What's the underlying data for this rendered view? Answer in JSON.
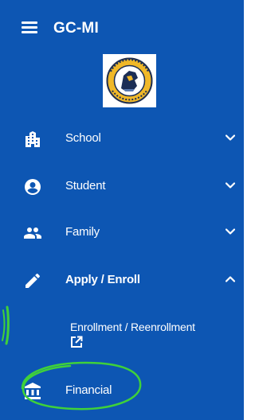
{
  "header": {
    "title": "GC-MI",
    "menu_icon": "hamburger-menu-icon"
  },
  "logo": {
    "icon": "school-crest-logo",
    "lettering": "GRACE CHRISTIAN SCHOOL"
  },
  "nav": {
    "items": [
      {
        "label": "School",
        "icon": "building-icon",
        "expanded": false,
        "chevron": "chevron-down-icon"
      },
      {
        "label": "Student",
        "icon": "account-circle-icon",
        "expanded": false,
        "chevron": "chevron-down-icon"
      },
      {
        "label": "Family",
        "icon": "people-icon",
        "expanded": false,
        "chevron": "chevron-down-icon"
      },
      {
        "label": "Apply / Enroll",
        "icon": "pencil-icon",
        "expanded": true,
        "chevron": "chevron-up-icon"
      }
    ],
    "subitem": {
      "label": "Enrollment / Reenrollment",
      "icon": "external-link-icon"
    },
    "financial": {
      "label": "Financial",
      "icon": "bank-icon"
    }
  },
  "colors": {
    "sidebar_background": "#0d56b3",
    "text": "#ffffff",
    "annotation": "#3fd13a"
  }
}
